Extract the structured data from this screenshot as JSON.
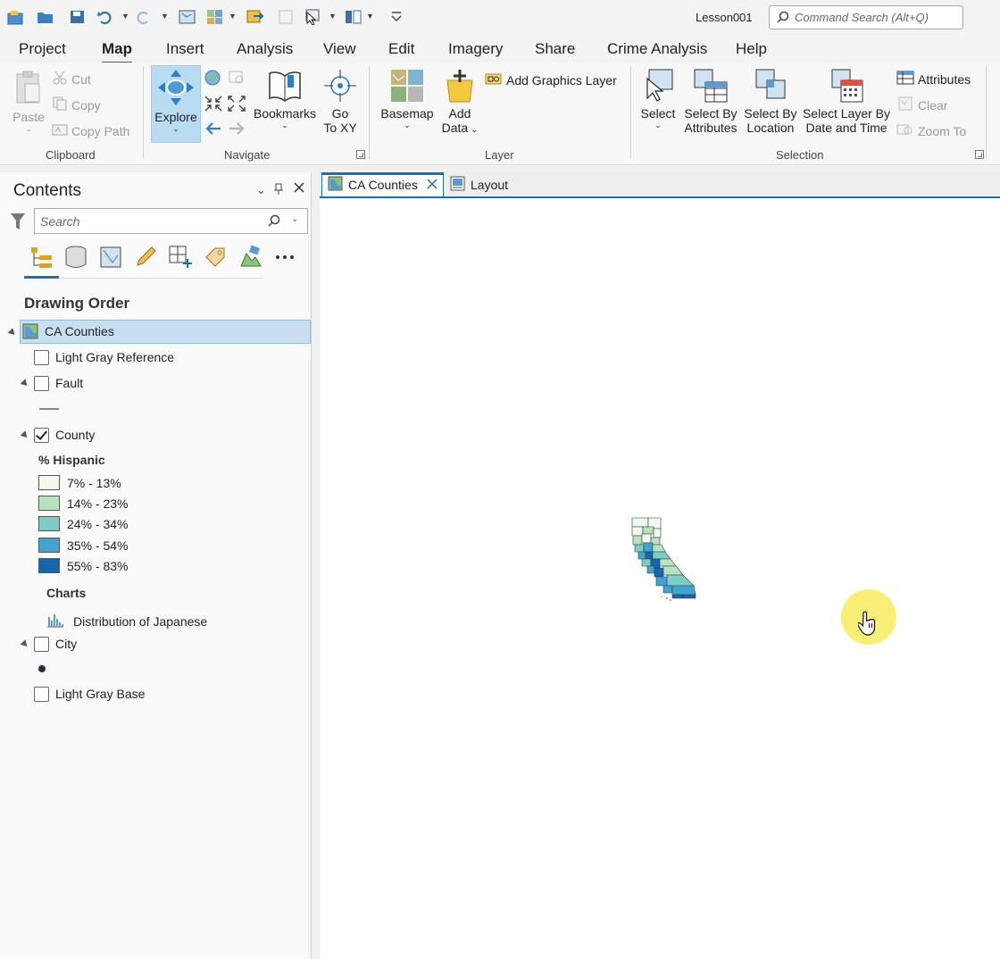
{
  "app": {
    "project_name": "Lesson001",
    "command_search_placeholder": "Command Search (Alt+Q)"
  },
  "ribbon_tabs": [
    "Project",
    "Map",
    "Insert",
    "Analysis",
    "View",
    "Edit",
    "Imagery",
    "Share",
    "Crime Analysis",
    "Help"
  ],
  "active_tab": "Map",
  "ribbon": {
    "clipboard": {
      "label": "Clipboard",
      "paste": "Paste",
      "cut": "Cut",
      "copy": "Copy",
      "copy_path": "Copy Path"
    },
    "navigate": {
      "label": "Navigate",
      "explore": "Explore",
      "bookmarks": "Bookmarks",
      "go_to_xy_line1": "Go",
      "go_to_xy_line2": "To XY"
    },
    "layer": {
      "label": "Layer",
      "basemap": "Basemap",
      "add_data_line1": "Add",
      "add_data_line2": "Data",
      "add_graphics_layer": "Add Graphics Layer"
    },
    "selection": {
      "label": "Selection",
      "select": "Select",
      "select_by_attributes_line1": "Select By",
      "select_by_attributes_line2": "Attributes",
      "select_by_location_line1": "Select By",
      "select_by_location_line2": "Location",
      "select_layer_by_date_line1": "Select Layer By",
      "select_layer_by_date_line2": "Date and Time",
      "attributes": "Attributes",
      "clear": "Clear",
      "zoom_to": "Zoom To"
    }
  },
  "contents": {
    "title": "Contents",
    "search_placeholder": "Search",
    "section_title": "Drawing Order",
    "map_name": "CA Counties",
    "layers": {
      "light_gray_reference": "Light Gray Reference",
      "fault": "Fault",
      "county": "County",
      "city": "City",
      "light_gray_base": "Light Gray Base"
    },
    "legend": {
      "field": "% Hispanic",
      "classes": [
        {
          "label": "7% - 13%",
          "color": "#f1f9ec"
        },
        {
          "label": "14% - 23%",
          "color": "#b9e3bc"
        },
        {
          "label": "24% - 34%",
          "color": "#7ccdc5"
        },
        {
          "label": "35% - 54%",
          "color": "#41a4d0"
        },
        {
          "label": "55% - 83%",
          "color": "#1666ad"
        }
      ]
    },
    "charts_heading": "Charts",
    "chart_name": "Distribution of Japanese"
  },
  "document_tabs": {
    "map_tab": "CA Counties",
    "layout_tab": "Layout"
  },
  "colors": {
    "accent": "#1a6fb3",
    "selection_bg": "#c9dfef",
    "cursor_halo": "#f7ec5c"
  }
}
